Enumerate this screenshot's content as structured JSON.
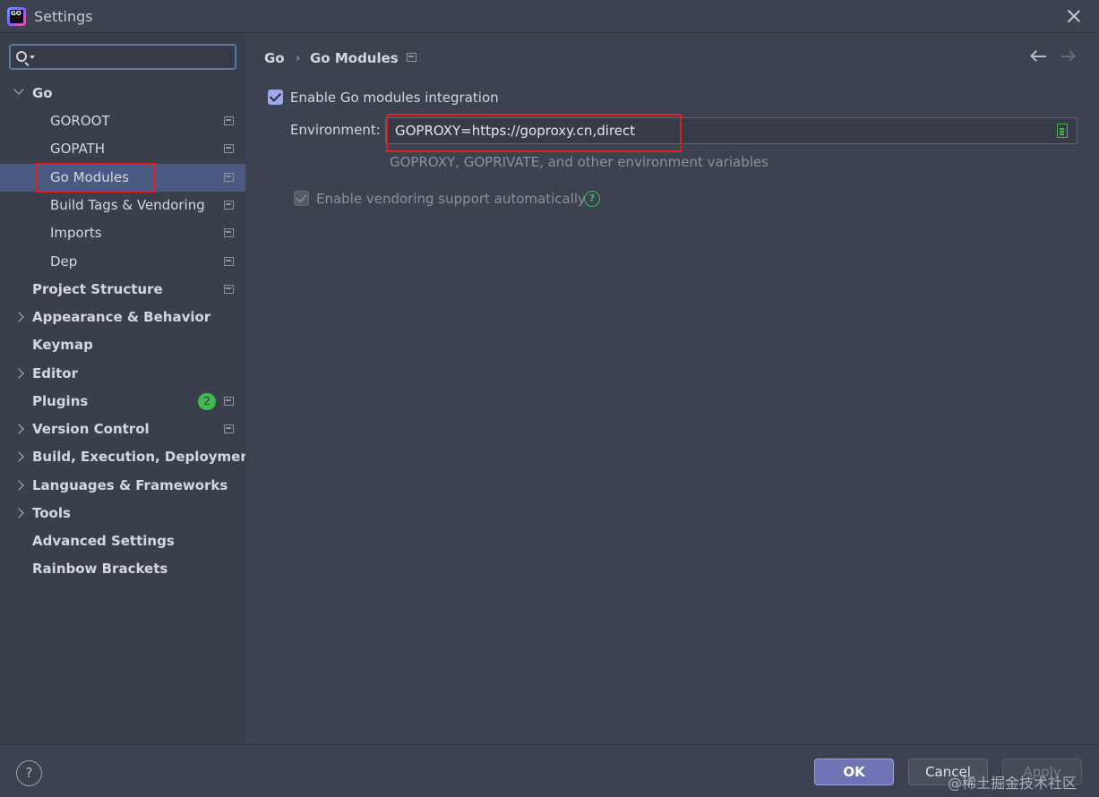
{
  "window": {
    "title": "Settings",
    "app_icon_text": "GO"
  },
  "sidebar": {
    "search": {
      "value": "",
      "placeholder": ""
    },
    "items": [
      {
        "label": "Go",
        "bold": true,
        "expanded": true,
        "level": 0
      },
      {
        "label": "GOROOT",
        "level": 1
      },
      {
        "label": "GOPATH",
        "level": 1
      },
      {
        "label": "Go Modules",
        "level": 1,
        "selected": true
      },
      {
        "label": "Build Tags & Vendoring",
        "level": 1
      },
      {
        "label": "Imports",
        "level": 1
      },
      {
        "label": "Dep",
        "level": 1
      },
      {
        "label": "Project Structure",
        "bold": true,
        "level": 0
      },
      {
        "label": "Appearance & Behavior",
        "bold": true,
        "level": 0
      },
      {
        "label": "Keymap",
        "bold": true,
        "level": 0
      },
      {
        "label": "Editor",
        "bold": true,
        "level": 0
      },
      {
        "label": "Plugins",
        "bold": true,
        "level": 0,
        "badge": "2"
      },
      {
        "label": "Version Control",
        "bold": true,
        "level": 0
      },
      {
        "label": "Build, Execution, Deployment",
        "bold": true,
        "level": 0
      },
      {
        "label": "Languages & Frameworks",
        "bold": true,
        "level": 0
      },
      {
        "label": "Tools",
        "bold": true,
        "level": 0
      },
      {
        "label": "Advanced Settings",
        "bold": true,
        "level": 0
      },
      {
        "label": "Rainbow Brackets",
        "bold": true,
        "level": 0
      }
    ]
  },
  "breadcrumb": {
    "parent": "Go",
    "separator": "›",
    "current": "Go Modules"
  },
  "settings": {
    "enable_modules": {
      "label": "Enable Go modules integration",
      "checked": true
    },
    "environment": {
      "label": "Environment:",
      "value": "GOPROXY=https://goproxy.cn,direct",
      "hint": "GOPROXY, GOPRIVATE, and other environment variables"
    },
    "vendoring": {
      "label": "Enable vendoring support automatically",
      "checked": true,
      "disabled": true
    }
  },
  "footer": {
    "help": "?",
    "ok": "OK",
    "cancel": "Cancel",
    "apply": "Apply"
  },
  "watermark": "@稀土掘金技术社区",
  "colors": {
    "accent": "#4a5a82",
    "highlight": "#e02020",
    "badge": "#3fb950"
  }
}
